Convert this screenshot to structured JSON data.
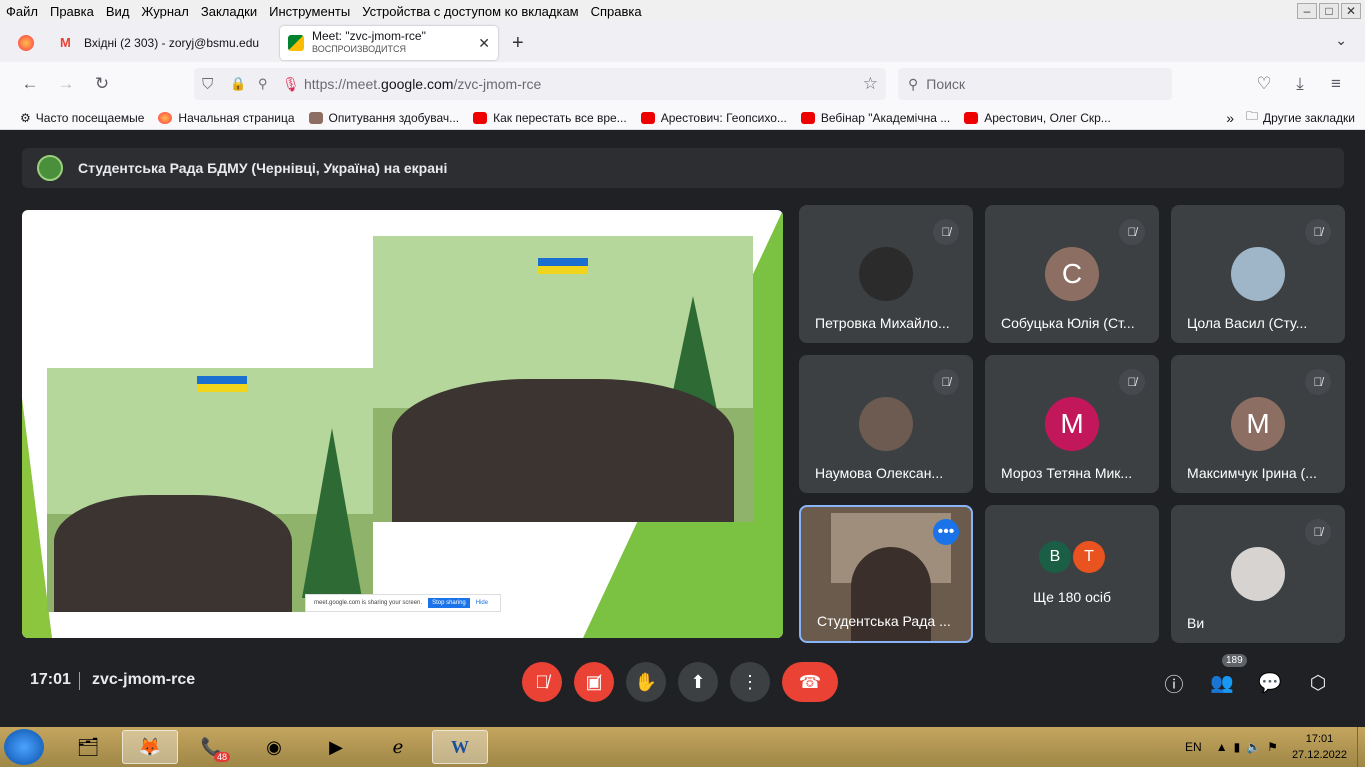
{
  "menu": [
    "Файл",
    "Правка",
    "Вид",
    "Журнал",
    "Закладки",
    "Инструменты",
    "Устройства с доступом ко вкладкам",
    "Справка"
  ],
  "tabs": [
    {
      "title": "Вхідні (2 303) - zoryj@bsmu.edu",
      "active": false
    },
    {
      "title": "Meet: \"zvc-jmom-rce\"",
      "subtitle": "ВОСПРОИЗВОДИТСЯ",
      "active": true
    }
  ],
  "url": {
    "prefix": "https://meet.",
    "domain": "google.com",
    "path": "/zvc-jmom-rce"
  },
  "search_placeholder": "Поиск",
  "bookmarks": [
    "Часто посещаемые",
    "Начальная страница",
    "Опитування здобувач...",
    "Как перестать все вре...",
    "Арестович: Геопсихо...",
    "Вебінар \"Академічна ...",
    "Арестович, Олег Скр...",
    "Другие закладки"
  ],
  "presenter_bar": "Студентська Рада БДМУ (Чернівці, Україна) на екрані",
  "share_banner": {
    "text": "meet.google.com is sharing your screen.",
    "stop": "Stop sharing",
    "hide": "Hide"
  },
  "participants": [
    {
      "name": "Петровка Михайло...",
      "letter": "",
      "color": "#2b2b2b"
    },
    {
      "name": "Собуцька Юлія (Ст...",
      "letter": "С",
      "color": "#8d6e63"
    },
    {
      "name": "Цола Васил (Сту...",
      "letter": "",
      "color": "#9fb6c8"
    },
    {
      "name": "Наумова Олексан...",
      "letter": "",
      "color": "#6d5b52"
    },
    {
      "name": "Мороз Тетяна Мик...",
      "letter": "М",
      "color": "#c2185b"
    },
    {
      "name": "Максимчук Ірина (...",
      "letter": "М",
      "color": "#8d6e63"
    },
    {
      "name": "Студентська Рада ...",
      "letter": "",
      "color": "#6b5b4d"
    },
    {
      "name": "Ще 180 осіб",
      "letter": "",
      "color": ""
    },
    {
      "name": "Ви",
      "letter": "",
      "color": "#d6d3d1"
    }
  ],
  "others": {
    "a": "B",
    "b": "T"
  },
  "clock": "17:01",
  "meeting_code": "zvc-jmom-rce",
  "people_count": "189",
  "tray": {
    "lang": "EN",
    "time": "17:01",
    "date": "27.12.2022"
  },
  "taskbar_badge": "48"
}
